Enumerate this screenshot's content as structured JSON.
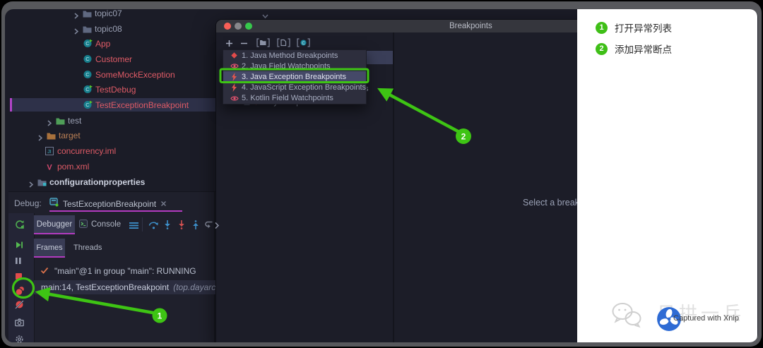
{
  "colors": {
    "annotation_green": "#3ec414",
    "accent_underline": "#b23bbf",
    "class_red": "#df5b66",
    "traffic_close": "#f95f57",
    "traffic_minimize": "#87878b",
    "traffic_zoom": "#37c84c"
  },
  "project_tree": {
    "items": [
      {
        "label": "topic07",
        "icon": "folder-icon",
        "chevron": true,
        "indent": 104,
        "color": "dim"
      },
      {
        "label": "topic08",
        "icon": "folder-icon",
        "chevron": true,
        "indent": 104,
        "color": "dim"
      },
      {
        "label": "App",
        "icon": "runnable-class-icon",
        "chevron": false,
        "indent": 105,
        "color": "red"
      },
      {
        "label": "Customer",
        "icon": "class-icon",
        "chevron": false,
        "indent": 105,
        "color": "red"
      },
      {
        "label": "SomeMockException",
        "icon": "class-icon",
        "chevron": false,
        "indent": 105,
        "color": "red"
      },
      {
        "label": "TestDebug",
        "icon": "runnable-class-icon",
        "chevron": false,
        "indent": 105,
        "color": "red"
      },
      {
        "label": "TestExceptionBreakpoint",
        "icon": "runnable-class-icon",
        "chevron": false,
        "indent": 105,
        "color": "red",
        "selected": true
      },
      {
        "label": "test",
        "icon": "test-folder-icon",
        "chevron": true,
        "indent": 66,
        "color": "dim"
      },
      {
        "label": "target",
        "icon": "target-folder-icon",
        "chevron": true,
        "indent": 53,
        "color": "orange"
      },
      {
        "label": "concurrency.iml",
        "icon": "module-iml-icon",
        "chevron": false,
        "indent": 51,
        "color": "red"
      },
      {
        "label": "pom.xml",
        "icon": "maven-icon",
        "chevron": false,
        "indent": 51,
        "color": "red"
      },
      {
        "label": "configurationproperties",
        "icon": "config-folder-icon",
        "chevron": true,
        "indent": 40,
        "color": "bold"
      }
    ]
  },
  "debug": {
    "label": "Debug:",
    "session_tab": "TestExceptionBreakpoint",
    "tabs": [
      {
        "label": "Debugger",
        "selected": true
      },
      {
        "label": "Console",
        "icon": "terminal-icon"
      }
    ],
    "subtabs": [
      {
        "label": "Frames",
        "selected": true
      },
      {
        "label": "Threads"
      }
    ],
    "thread_status": "\"main\"@1 in group \"main\": RUNNING",
    "frame_line": "main:14, TestExceptionBreakpoint",
    "frame_pkg": "(top.dayarch)",
    "gutter_icons": [
      "rerun-icon",
      "resume-icon",
      "pause-icon",
      "stop-icon",
      "view-breakpoints-icon",
      "mute-breakpoints-icon",
      "camera-icon",
      "settings-icon"
    ],
    "toolbar_icons": [
      "hamburger-icon",
      "step-over-icon",
      "step-into-icon",
      "force-step-into-icon",
      "step-out-icon",
      "drop-frame-icon"
    ]
  },
  "dialog": {
    "title": "Breakpoints",
    "toolbar_icons": [
      "add-icon",
      "remove-icon",
      "group-by-folder-icon",
      "group-by-file-icon",
      "group-by-class-icon"
    ],
    "popup_items": [
      {
        "label": "1. Java Method Breakpoints",
        "icon": "method-breakpoint-icon"
      },
      {
        "label": "2. Java Field Watchpoints",
        "icon": "field-watchpoint-icon"
      },
      {
        "label": "3. Java Exception Breakpoints",
        "icon": "exception-breakpoint-icon",
        "selected": true
      },
      {
        "label": "4. JavaScript Exception Breakpoints",
        "icon": "exception-breakpoint-icon"
      },
      {
        "label": "5. Kotlin Field Watchpoints",
        "icon": "field-watchpoint-icon"
      }
    ],
    "underlying": {
      "clipped_fragment": "s",
      "any_exception": "Any exception",
      "select_hint": "Select a breakp"
    }
  },
  "annotations": {
    "notes": [
      {
        "num": "1",
        "text": "打开异常列表"
      },
      {
        "num": "2",
        "text": "添加异常断点"
      }
    ]
  },
  "watermark": {
    "brand": "日拱一兵",
    "caption": "Captured with Xnip"
  }
}
